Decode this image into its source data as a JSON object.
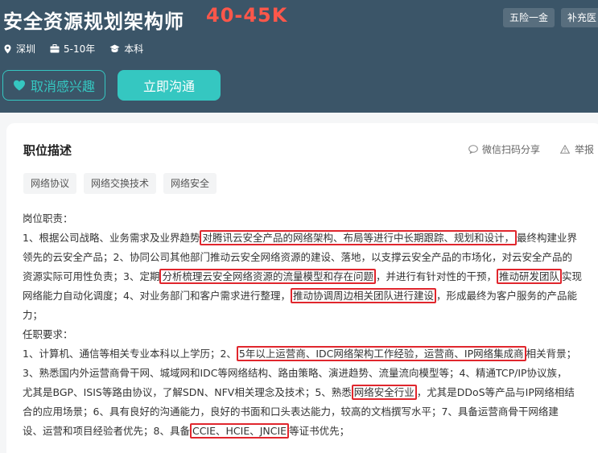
{
  "header": {
    "title": "安全资源规划架构师",
    "salary": "40-45K",
    "benefits": [
      "五险一金",
      "补充医"
    ],
    "location": "深圳",
    "experience": "5-10年",
    "education": "本科",
    "unfollow_label": "取消感兴趣",
    "chat_label": "立即沟通"
  },
  "colors": {
    "header_bg": "#3b5568",
    "salary": "#fe574a",
    "accent": "#35c7c1",
    "highlight_box": "#e0262d"
  },
  "detail": {
    "section_title": "职位描述",
    "share_label": "微信扫码分享",
    "report_label": "举报",
    "skill_tags": [
      "网络协议",
      "网络交换技术",
      "网络安全"
    ],
    "responsibilities_heading": "岗位职责：",
    "requirements_heading": "任职要求：",
    "lines": [
      [
        "1、根据公司战略、业务需求及业界趋势",
        "对腾讯云安全产品的网络架构、布局等进行中长期跟踪、规划和设计，",
        "最终构建业界"
      ],
      [
        "领先的云安全产品；2、协同公司其他部门推动云安全网络资源的建设、落地，以支撑云安全产品的市场化，对云安全产品的"
      ],
      [
        "资源实际可用性负责；3、定期",
        "分析梳理云安全网络资源的流量模型和存在问题",
        "，并进行有针对性的干预，",
        "推动研发团队",
        "实现"
      ],
      [
        "网络能力自动化调度；4、对业务部门和客户需求进行整理，",
        "推动协调周边相关团队进行建设",
        "，形成最终为客户服务的产品能"
      ],
      [
        "力；"
      ],
      [
        "1、计算机、通信等相关专业本科以上学历；2、",
        "5年以上运营商、IDC网络架构工作经验，运营商、IP网络集成商",
        "相关背景；"
      ],
      [
        "3、熟悉国内外运营商骨干网、城域网和IDC等网络结构、路由策略、演进趋势、流量流向模型等；4、精通TCP/IP协议族，"
      ],
      [
        "尤其是BGP、ISIS等路由协议，了解SDN、NFV相关理念及技术；5、熟悉",
        "网络安全行业",
        "，尤其是DDoS等产品与IP网络相结"
      ],
      [
        "合的应用场景；6、具有良好的沟通能力，良好的书面和口头表达能力，较高的文档撰写水平；7、具备运营商骨干网络建"
      ],
      [
        "设、运营和项目经验者优先；8、具备",
        "CCIE、HCIE、JNCIE",
        "等证书优先；"
      ]
    ]
  }
}
